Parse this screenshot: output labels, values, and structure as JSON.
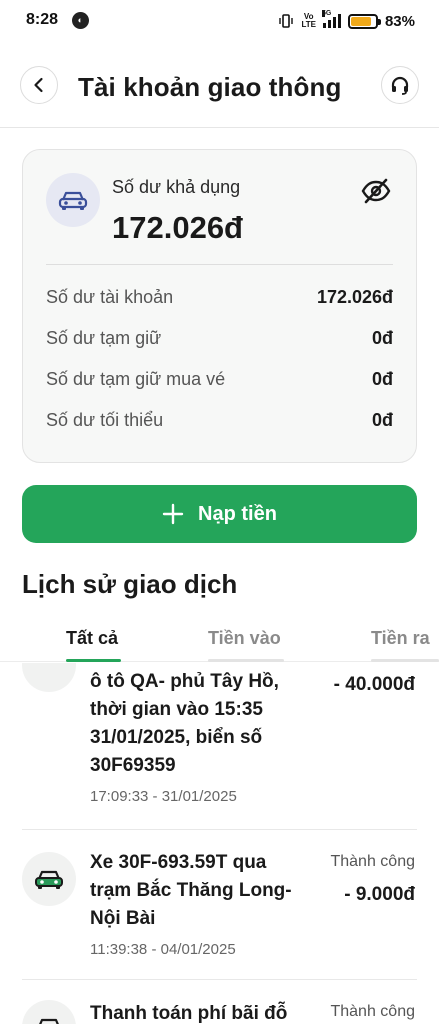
{
  "status_bar": {
    "time": "8:28",
    "volte_top": "Vo",
    "volte_bottom": "LTE",
    "network": "5G",
    "battery_percent": "83%",
    "battery_level": 0.83,
    "battery_color": "#f0a91a"
  },
  "header": {
    "title": "Tài khoản giao thông"
  },
  "balance_card": {
    "available_label": "Số dư khả dụng",
    "available_amount": "172.026đ",
    "rows": [
      {
        "label": "Số dư tài khoản",
        "value": "172.026đ"
      },
      {
        "label": "Số dư tạm giữ",
        "value": "0đ"
      },
      {
        "label": "Số dư tạm giữ mua vé",
        "value": "0đ"
      },
      {
        "label": "Số dư tối thiểu",
        "value": "0đ"
      }
    ]
  },
  "topup": {
    "label": "Nạp tiền",
    "color": "#24a55a"
  },
  "history": {
    "title": "Lịch sử giao dịch",
    "tabs": [
      {
        "label": "Tất cả",
        "active": true
      },
      {
        "label": "Tiền vào",
        "active": false
      },
      {
        "label": "Tiền ra",
        "active": false
      }
    ],
    "transactions": [
      {
        "title_lines": [
          "ô tô QA- phủ Tây Hồ,",
          "thời gian vào 15:35",
          "31/01/2025, biển số",
          "30F69359"
        ],
        "time": "17:09:33 - 31/01/2025",
        "status": "",
        "amount": "- 40.000đ"
      },
      {
        "title_lines": [
          "Xe 30F-693.59T qua",
          "trạm Bắc Thăng Long-",
          "Nội Bài"
        ],
        "time": "11:39:38 - 04/01/2025",
        "status": "Thành công",
        "amount": "- 9.000đ"
      },
      {
        "title_lines": [
          "Thanh toán phí bãi đỗ"
        ],
        "time": "",
        "status": "Thành công",
        "amount": ""
      }
    ]
  }
}
